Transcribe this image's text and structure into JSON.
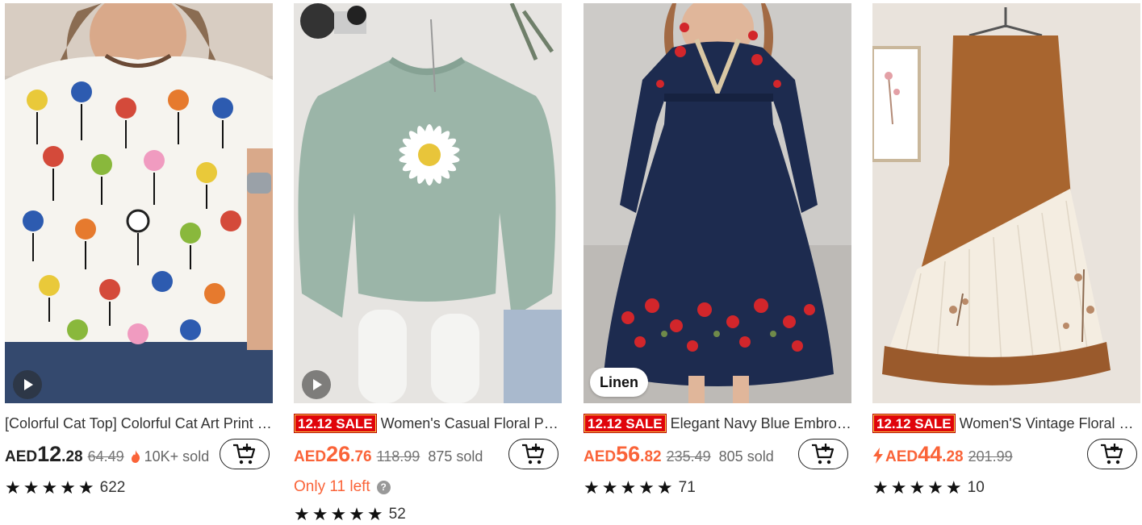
{
  "products": [
    {
      "title": "[Colorful Cat Top] Colorful Cat Art Print Crew Neck T-Shirt",
      "sale_badge": "",
      "currency": "AED",
      "price_int": "12",
      "price_dec": ".28",
      "original_price": "64.49",
      "sold": "10K+ sold",
      "stock_note": "",
      "rating_stars": "★★★★★",
      "rating_count": "622",
      "has_video": true,
      "image_tag": ""
    },
    {
      "title": "Women's Casual Floral Print Sweatshirt",
      "sale_badge": "12.12 SALE",
      "currency": "AED",
      "price_int": "26",
      "price_dec": ".76",
      "original_price": "118.99",
      "sold": "875 sold",
      "stock_note": "Only 11 left",
      "rating_stars": "★★★★★",
      "rating_count": "52",
      "has_video": true,
      "image_tag": ""
    },
    {
      "title": "Elegant Navy Blue Embroidered Dress",
      "sale_badge": "12.12 SALE",
      "currency": "AED",
      "price_int": "56",
      "price_dec": ".82",
      "original_price": "235.49",
      "sold": "805 sold",
      "stock_note": "",
      "rating_stars": "★★★★★",
      "rating_count": "71",
      "has_video": false,
      "image_tag": "Linen"
    },
    {
      "title": "Women'S Vintage Floral Skirt",
      "sale_badge": "12.12 SALE",
      "currency": "AED",
      "price_int": "44",
      "price_dec": ".28",
      "original_price": "201.99",
      "sold": "",
      "stock_note": "",
      "rating_stars": "★★★★★",
      "rating_count": "10",
      "has_video": false,
      "image_tag": ""
    }
  ],
  "icons": {
    "cart": "add-to-cart-icon",
    "video": "play-icon",
    "flame": "flame-icon",
    "bolt": "lightning-bolt-icon",
    "help": "question-icon"
  },
  "colors": {
    "price_accent": "#fa6338",
    "sale_red": "#e0040b"
  }
}
